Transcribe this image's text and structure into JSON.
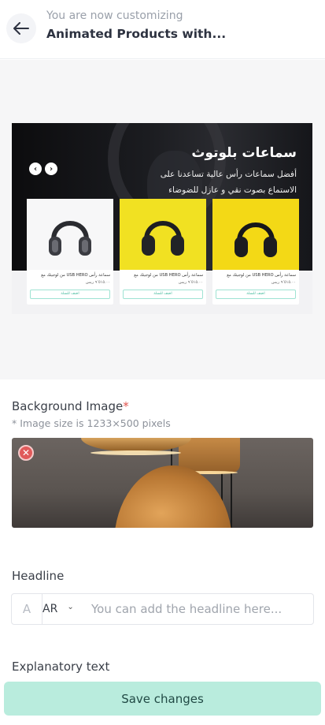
{
  "header": {
    "subtitle": "You are now customizing",
    "title": "Animated Products with..."
  },
  "preview": {
    "banner_title": "سماعات بلوتوث",
    "banner_description": "أفضل سماعات رأس عالية تساعدنا على الاستماع بصوت نقي و عازل للضوضاء",
    "products": [
      {
        "name": "سماعة رأس USB HERO من لوجيتك مع",
        "price": "٩٬٥١٥.٠٠ ريس",
        "button": "اضف للسلة"
      },
      {
        "name": "سماعة رأس USB HERO من لوجيتك مع",
        "price": "٩٬٥١٥.٠٠ ريس",
        "button": "اضف للسلة"
      },
      {
        "name": "سماعة رأس USB HERO من لوجيتك مع",
        "price": "٩٬٥١٥.٠٠ ريس",
        "button": "اضف للسلة"
      }
    ]
  },
  "background_image": {
    "label": "Background Image",
    "required_mark": "*",
    "hint": "* Image size is 1233×500 pixels"
  },
  "headline": {
    "label": "Headline",
    "lang_icon": "A",
    "language": "AR",
    "placeholder": "You can add the headline here..."
  },
  "explanatory": {
    "label": "Explanatory text"
  },
  "footer": {
    "save_label": "Save changes"
  },
  "colors": {
    "accent": "#b9ecdd",
    "danger": "#e05a5a"
  }
}
